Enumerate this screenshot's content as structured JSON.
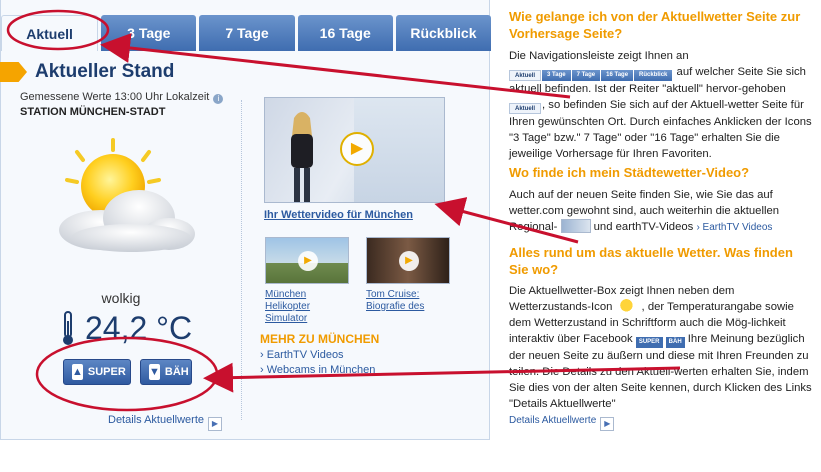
{
  "tabs": [
    {
      "label": "Aktuell",
      "active": true
    },
    {
      "label": "3 Tage",
      "active": false
    },
    {
      "label": "7 Tage",
      "active": false
    },
    {
      "label": "16 Tage",
      "active": false
    },
    {
      "label": "Rückblick",
      "active": false
    }
  ],
  "current": {
    "title": "Aktueller Stand",
    "measured": "Gemessene Werte 13:00 Uhr Lokalzeit",
    "station": "STATION MÜNCHEN-STADT",
    "condition": "wolkig",
    "temperature": "24,2 °C",
    "super_label": "SUPER",
    "bah_label": "BÄH",
    "details_link": "Details Aktuellwerte"
  },
  "video": {
    "main_title": "Ihr Wettervideo für München",
    "thumb1_title": "München Helikopter Simulator",
    "thumb2_title": "Tom Cruise: Biografie des"
  },
  "more": {
    "title": "MEHR ZU MÜNCHEN",
    "item1": "› EarthTV Videos",
    "item2": "› Webcams in München"
  },
  "faq": {
    "q1": "Wie gelange ich von der Aktuellwetter Seite zur Vorhersage Seite?",
    "a1_part1": "Die Navigationsleiste zeigt Ihnen an",
    "a1_part2": "auf welcher Seite Sie sich aktuell befinden. Ist der Reiter \"aktuell\" hervor-gehoben",
    "a1_part3": ", so befinden Sie sich auf der Aktuell-wetter Seite für Ihren gewünschten Ort. Durch einfaches Anklicken der Icons \"3 Tage\" bzw.\" 7 Tage\" oder \"16 Tage\" erhalten Sie die jeweilige Vorhersage für Ihren Favoriten.",
    "q2": "Wo finde ich mein Städtewetter-Video?",
    "a2_part1": "Auch auf der neuen Seite finden Sie, wie Sie das auf wetter.com gewohnt sind, auch weiterhin die aktuellen Regional-",
    "a2_part2": "und earthTV-Videos",
    "a2_link": "› EarthTV Videos",
    "q3": "Alles rund um das aktuelle Wetter. Was finden Sie wo?",
    "a3_part1": "Die Aktuellwetter-Box zeigt Ihnen neben dem Wetterzustands-Icon",
    "a3_part2": ", der Temperaturangabe sowie dem Wetterzustand in Schriftform auch die Mög-lichkeit interaktiv über Facebook",
    "a3_part3": "Ihre Meinung bezüglich der neuen Seite zu äußern und diese mit Ihren Freunden zu teilen. Die Details zu den Aktuell-werten erhalten Sie, indem Sie dies von der alten Seite kennen, durch Klicken des Links \"Details Aktuellwerte\"",
    "a3_link": "Details Aktuellwerte",
    "mini_tabs": [
      "Aktuell",
      "3 Tage",
      "7 Tage",
      "16 Tage",
      "Rückblick"
    ],
    "mini_active": "Aktuell",
    "mini_super": "SUPER",
    "mini_bah": "BÄH"
  },
  "colors": {
    "accent_orange": "#f09b00",
    "nav_blue": "#3f6db0",
    "annotation_red": "#c8102e"
  }
}
